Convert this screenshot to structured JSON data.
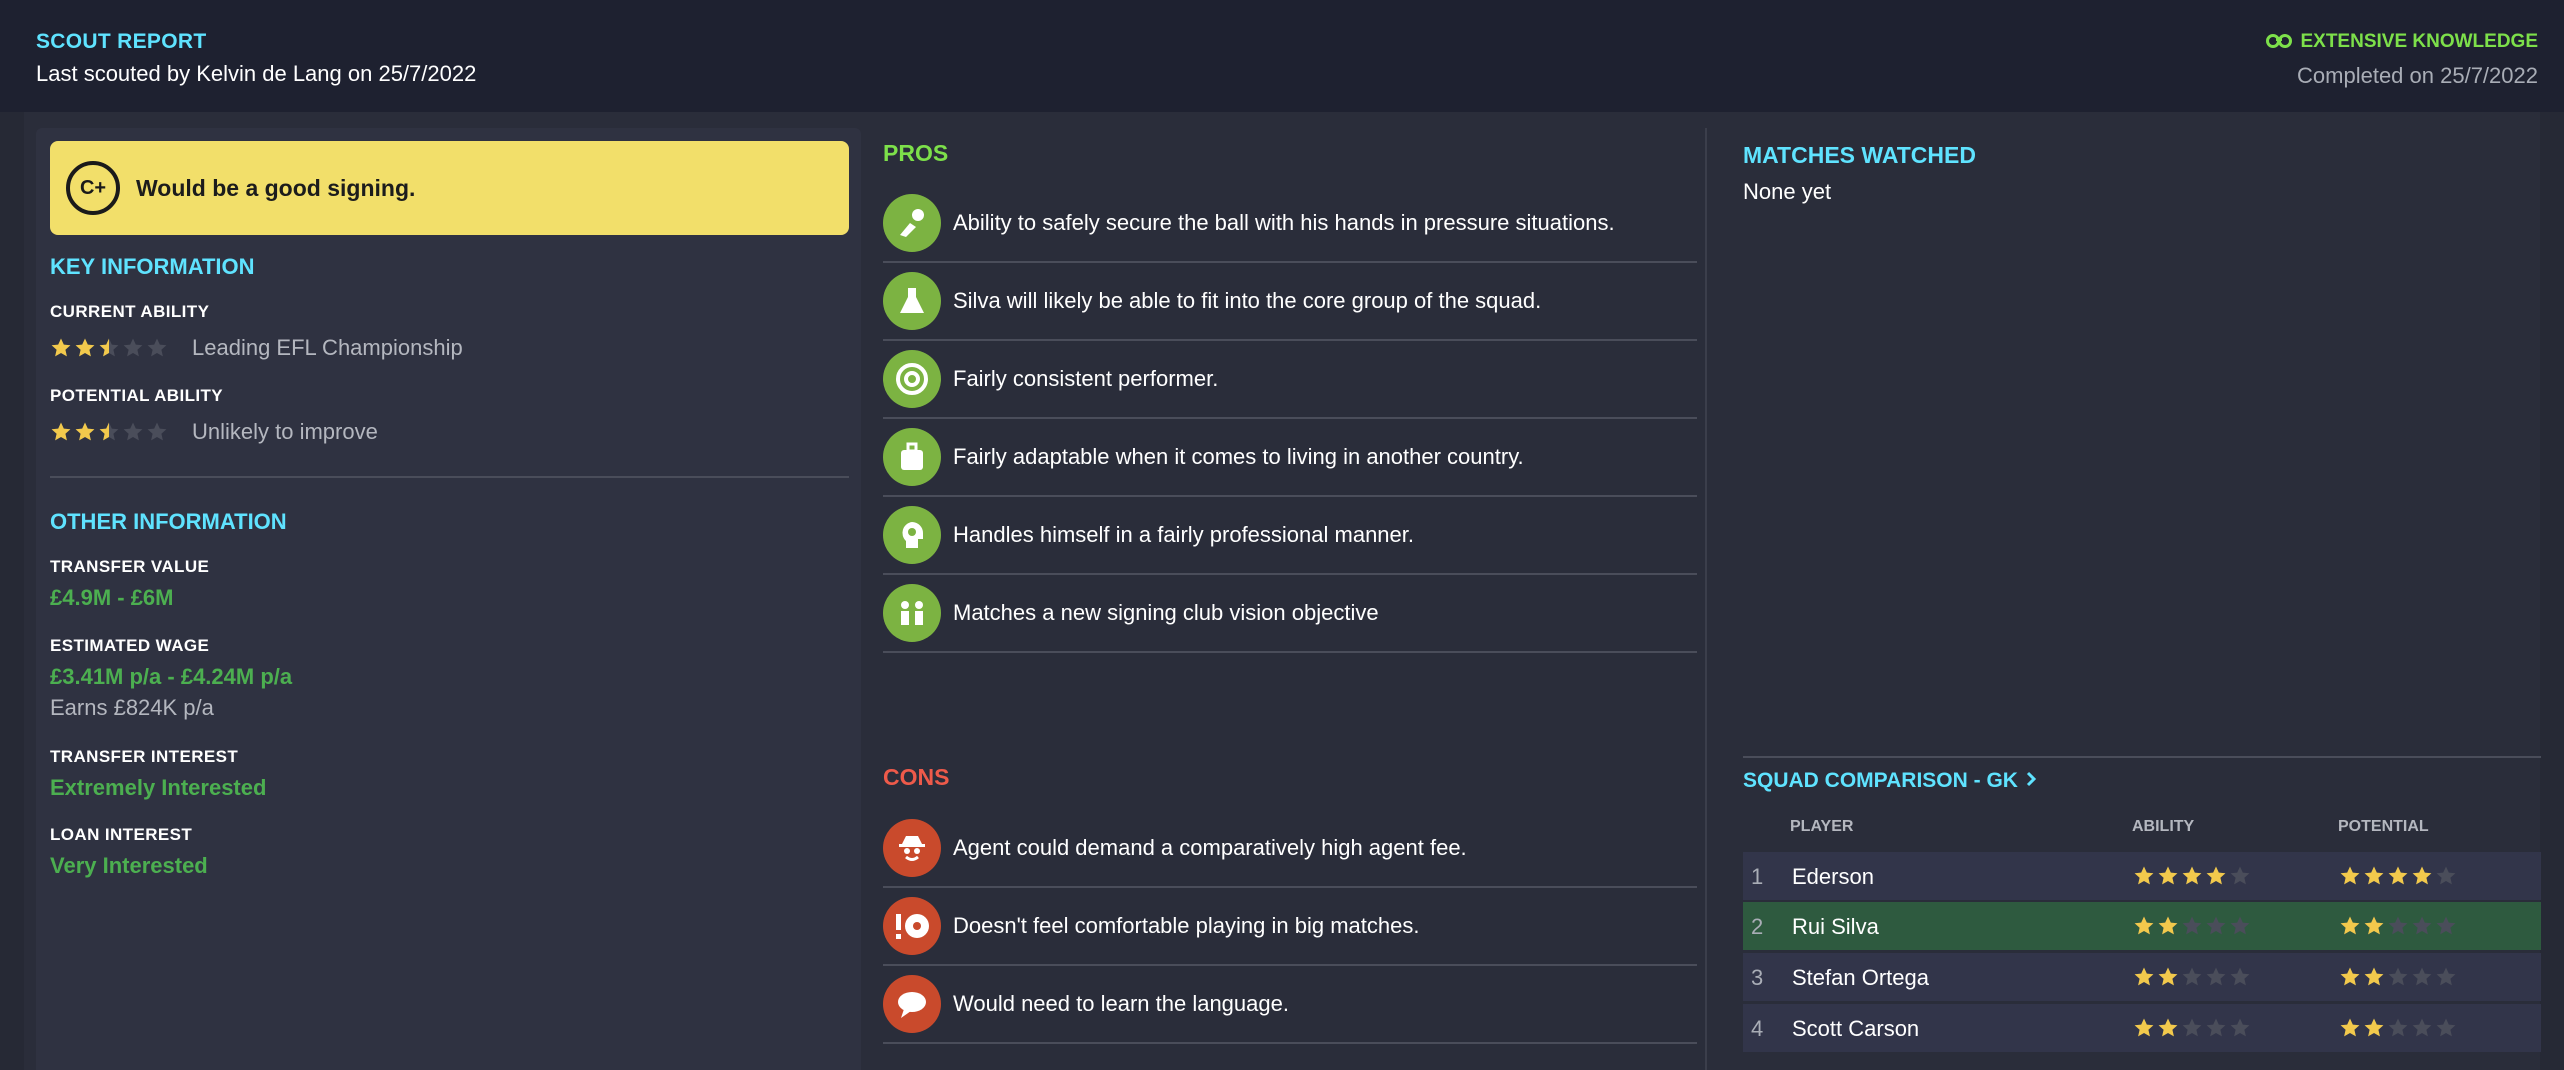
{
  "header": {
    "title": "SCOUT REPORT",
    "subtitle": "Last scouted by Kelvin de Lang on 25/7/2022",
    "knowledge": "EXTENSIVE KNOWLEDGE",
    "completed": "Completed on 25/7/2022"
  },
  "verdict": {
    "grade": "C+",
    "text": "Would be a good signing."
  },
  "key_information": {
    "title": "KEY INFORMATION",
    "current_ability": {
      "label": "CURRENT ABILITY",
      "stars": 2.5,
      "text": "Leading EFL Championship"
    },
    "potential_ability": {
      "label": "POTENTIAL ABILITY",
      "stars": 2.5,
      "text": "Unlikely to improve"
    }
  },
  "other_information": {
    "title": "OTHER INFORMATION",
    "transfer_value": {
      "label": "TRANSFER VALUE",
      "value": "£4.9M - £6M"
    },
    "estimated_wage": {
      "label": "ESTIMATED WAGE",
      "value": "£3.41M p/a - £4.24M p/a",
      "earns": "Earns £824K p/a"
    },
    "transfer_interest": {
      "label": "TRANSFER INTEREST",
      "value": "Extremely Interested"
    },
    "loan_interest": {
      "label": "LOAN INTEREST",
      "value": "Very Interested"
    }
  },
  "pros": {
    "title": "PROS",
    "items": [
      {
        "icon": "hands-ball-icon",
        "text": "Ability to safely secure the ball with his hands in pressure situations."
      },
      {
        "icon": "flask-icon",
        "text": "Silva will likely be able to fit into the core group of the squad."
      },
      {
        "icon": "target-icon",
        "text": "Fairly consistent performer."
      },
      {
        "icon": "suitcase-icon",
        "text": "Fairly adaptable when it comes to living in another country."
      },
      {
        "icon": "head-icon",
        "text": "Handles himself in a fairly professional manner."
      },
      {
        "icon": "group-icon",
        "text": "Matches a new signing club vision objective"
      }
    ]
  },
  "cons": {
    "title": "CONS",
    "items": [
      {
        "icon": "agent-icon",
        "text": "Agent could demand a comparatively high agent fee."
      },
      {
        "icon": "warning-ball-icon",
        "text": "Doesn't feel comfortable playing in big matches."
      },
      {
        "icon": "speech-bubble-icon",
        "text": "Would need to learn the language."
      }
    ]
  },
  "matches_watched": {
    "title": "MATCHES WATCHED",
    "text": "None yet"
  },
  "squad_comparison": {
    "title": "SQUAD COMPARISON - GK",
    "columns": {
      "player": "PLAYER",
      "ability": "ABILITY",
      "potential": "POTENTIAL"
    },
    "rows": [
      {
        "num": "1",
        "name": "Ederson",
        "ability": 4,
        "potential": 4,
        "highlight": false
      },
      {
        "num": "2",
        "name": "Rui Silva",
        "ability": 2,
        "potential": 2,
        "highlight": true
      },
      {
        "num": "3",
        "name": "Stefan Ortega",
        "ability": 2,
        "potential": 2,
        "highlight": false
      },
      {
        "num": "4",
        "name": "Scott Carson",
        "ability": 2,
        "potential": 2,
        "highlight": false
      }
    ]
  },
  "colors": {
    "accent": "#5fe3ff",
    "positive": "#7de04a",
    "negative": "#ee5a4a",
    "star_on": "#f2c94c",
    "star_off": "#4a4d5a"
  }
}
